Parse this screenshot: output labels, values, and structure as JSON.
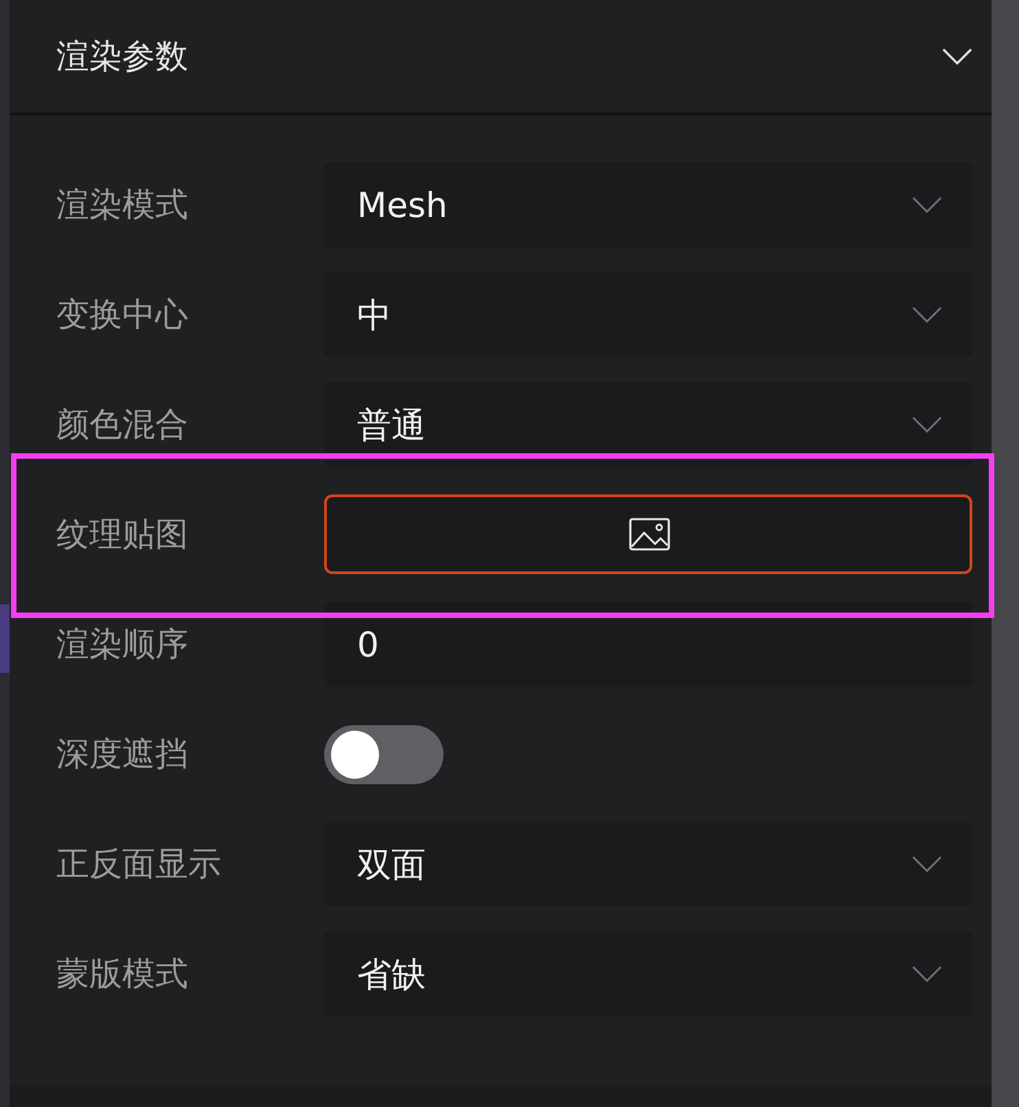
{
  "panel": {
    "title": "渲染参数",
    "expanded": true
  },
  "rows": [
    {
      "label": "渲染模式",
      "kind": "select",
      "value": "Mesh"
    },
    {
      "label": "变换中心",
      "kind": "select",
      "value": "中"
    },
    {
      "label": "颜色混合",
      "kind": "select",
      "value": "普通"
    },
    {
      "label": "纹理贴图",
      "kind": "image",
      "invalid": true,
      "highlighted": true
    },
    {
      "label": "渲染顺序",
      "kind": "number",
      "value": "0"
    },
    {
      "label": "深度遮挡",
      "kind": "toggle",
      "on": false
    },
    {
      "label": "正反面显示",
      "kind": "select",
      "value": "双面"
    },
    {
      "label": "蒙版模式",
      "kind": "select",
      "value": "省缺"
    }
  ]
}
